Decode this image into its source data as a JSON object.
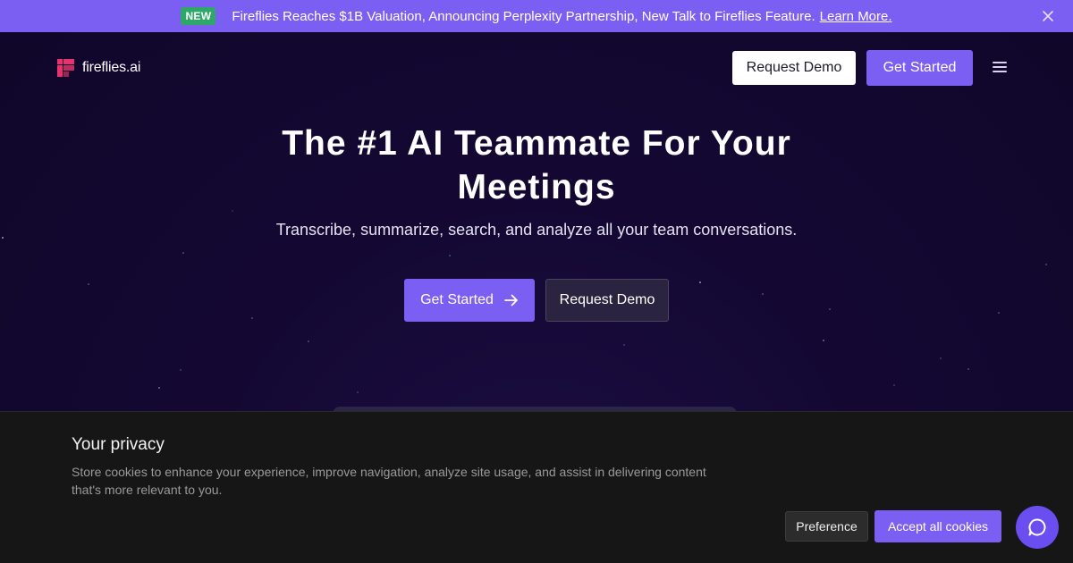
{
  "announcement": {
    "badge": "NEW",
    "text": "Fireflies Reaches $1B Valuation, Announcing Perplexity Partnership, New Talk to Fireflies Feature.",
    "link": "Learn More."
  },
  "header": {
    "logo_text": "fireflies.ai",
    "request_demo": "Request Demo",
    "get_started": "Get Started"
  },
  "hero": {
    "title": "The #1 AI Teammate For Your Meetings",
    "subtitle": "Transcribe, summarize, search, and analyze all your team conversations.",
    "get_started": "Get Started",
    "request_demo": "Request Demo"
  },
  "cookie": {
    "title": "Your privacy",
    "description": "Store cookies to enhance your experience, improve navigation, analyze site usage, and assist in delivering content that's more relevant to you.",
    "preference": "Preference",
    "accept": "Accept all cookies"
  },
  "colors": {
    "accent": "#7b5ff3",
    "badge_green": "#2ea868",
    "hero_background": "#13072e",
    "logo_pink": "#e8326e",
    "cookie_background": "#161616"
  },
  "icons": {
    "logo": "fireflies-logo-icon",
    "close": "close-icon",
    "menu": "hamburger-menu-icon",
    "arrow": "arrow-right-icon",
    "chat": "chat-bubble-icon"
  }
}
